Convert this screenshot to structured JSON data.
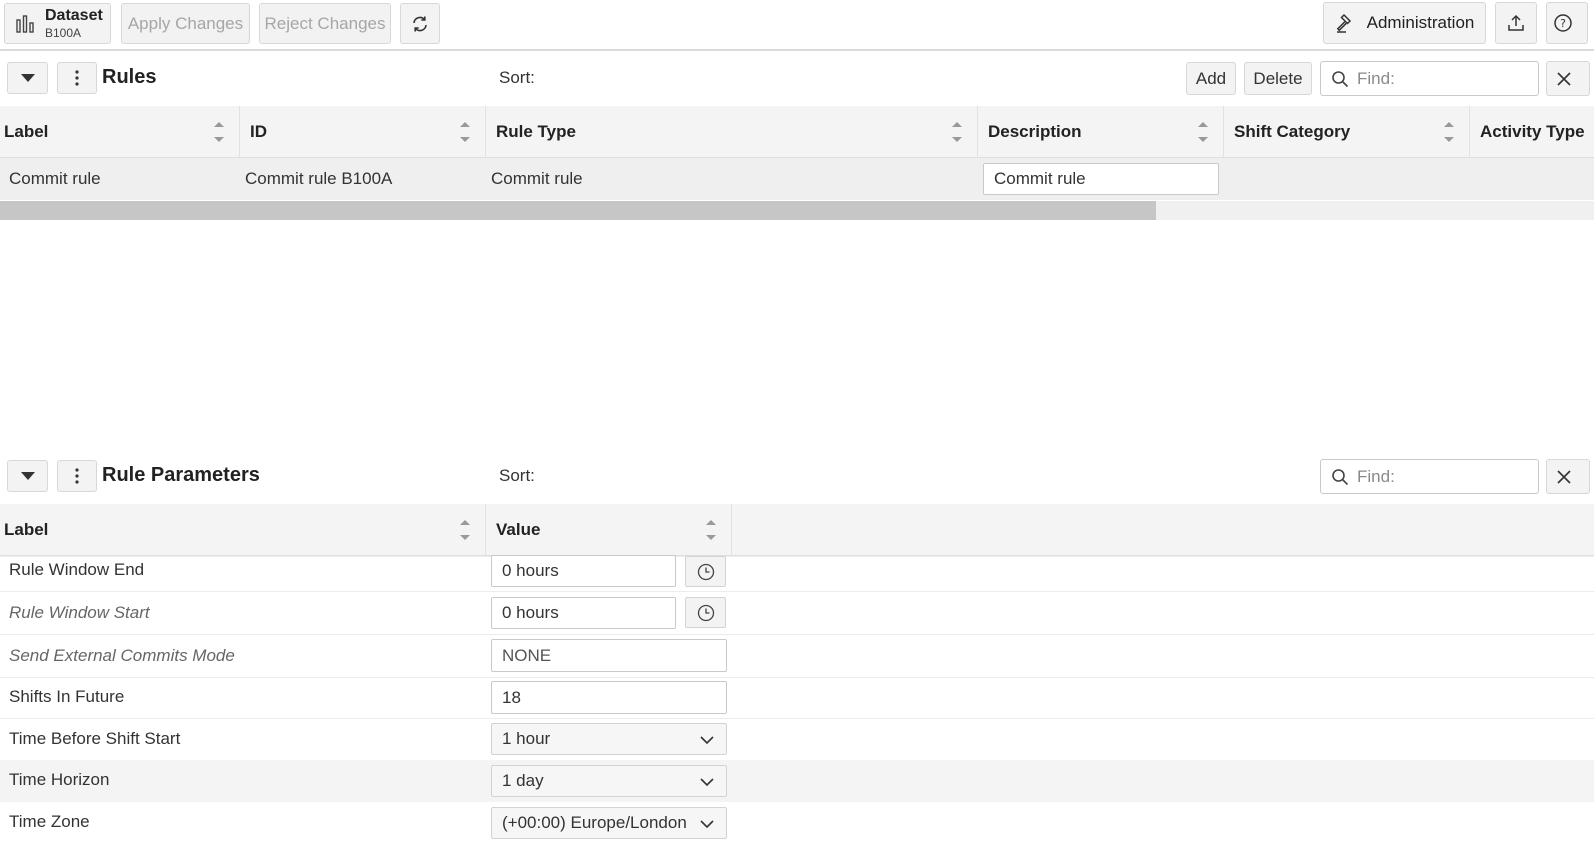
{
  "toolbar": {
    "dataset_label": "Dataset",
    "dataset_name": "B100A",
    "apply_label": "Apply Changes",
    "reject_label": "Reject Changes",
    "administration_label": "Administration"
  },
  "rules_panel": {
    "title": "Rules",
    "sort_label": "Sort:",
    "add_label": "Add",
    "delete_label": "Delete",
    "find_placeholder": "Find:",
    "columns": [
      "Label",
      "ID",
      "Rule Type",
      "Description",
      "Shift Category",
      "Activity Type"
    ],
    "rows": [
      {
        "label": "Commit rule",
        "id": "Commit rule B100A",
        "rule_type": "Commit rule",
        "description": "Commit rule",
        "shift_category": "",
        "activity_type": ""
      }
    ]
  },
  "params_panel": {
    "title": "Rule Parameters",
    "sort_label": "Sort:",
    "find_placeholder": "Find:",
    "columns": [
      "Label",
      "Value"
    ],
    "rows": [
      {
        "label": "Rule Window End",
        "value": "0 hours",
        "kind": "duration",
        "italic": false
      },
      {
        "label": "Rule Window Start",
        "value": "0 hours",
        "kind": "duration",
        "italic": true
      },
      {
        "label": "Send External Commits Mode",
        "value": "NONE",
        "kind": "text",
        "italic": true
      },
      {
        "label": "Shifts In Future",
        "value": "18",
        "kind": "text",
        "italic": false
      },
      {
        "label": "Time Before Shift Start",
        "value": "1 hour",
        "kind": "select",
        "italic": false
      },
      {
        "label": "Time Horizon",
        "value": "1 day",
        "kind": "select",
        "italic": false
      },
      {
        "label": "Time Zone",
        "value": "(+00:00) Europe/London",
        "kind": "select",
        "italic": false
      }
    ]
  },
  "icons": {
    "dataset": "bar-chart-icon",
    "refresh": "refresh-icon",
    "administration": "gavel-icon",
    "export": "export-icon",
    "help": "help-icon",
    "collapse": "caret-down-icon",
    "menu": "kebab-menu-icon",
    "search": "search-icon",
    "close": "close-icon",
    "clock": "clock-icon",
    "chevron": "chevron-down-icon"
  }
}
